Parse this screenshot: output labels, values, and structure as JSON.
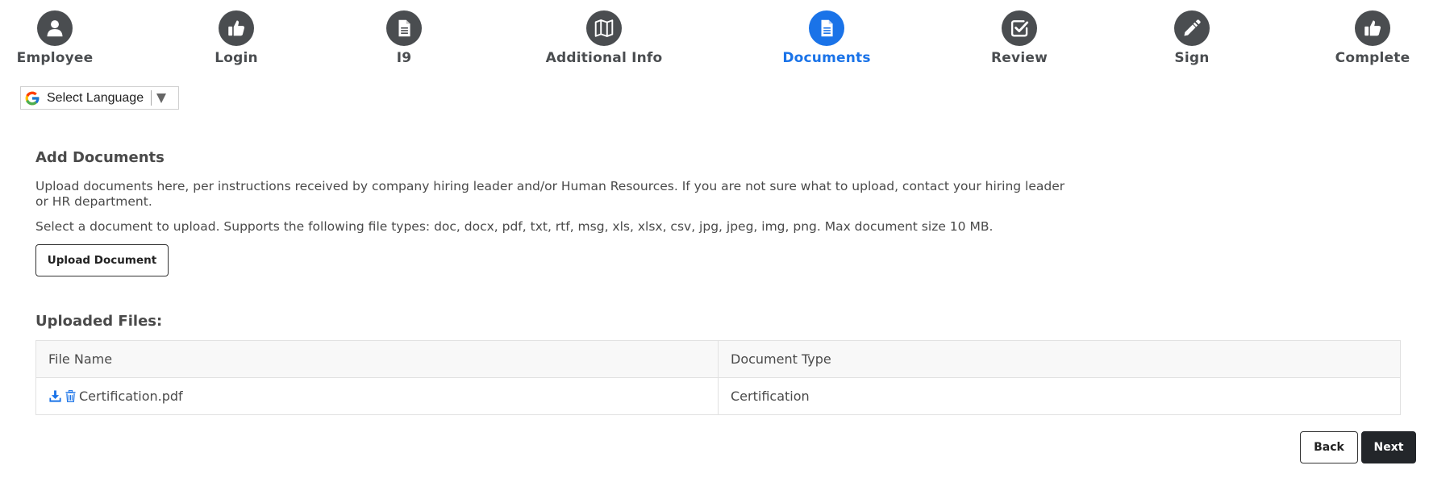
{
  "stepper": {
    "steps": [
      {
        "label": "Employee",
        "icon": "user-icon",
        "state": "default"
      },
      {
        "label": "Login",
        "icon": "thumbs-up-icon",
        "state": "default"
      },
      {
        "label": "I9",
        "icon": "document-icon",
        "state": "default"
      },
      {
        "label": "Additional Info",
        "icon": "map-icon",
        "state": "default"
      },
      {
        "label": "Documents",
        "icon": "document-icon",
        "state": "active"
      },
      {
        "label": "Review",
        "icon": "check-square-icon",
        "state": "default"
      },
      {
        "label": "Sign",
        "icon": "pencil-icon",
        "state": "default"
      },
      {
        "label": "Complete",
        "icon": "thumbs-up-icon",
        "state": "default"
      }
    ],
    "colors": {
      "default": "#4a4d50",
      "active": "#1a73e8"
    }
  },
  "language": {
    "label": "Select Language",
    "icon": "google-icon"
  },
  "add_documents": {
    "title": "Add Documents",
    "instructions": "Upload documents here, per instructions received by company hiring leader and/or Human Resources. If you are not sure what to upload, contact your hiring leader or HR department.",
    "filetypes": "Select a document to upload. Supports the following file types: doc, docx, pdf, txt, rtf, msg, xls, xlsx, csv, jpg, jpeg, img, png. Max document size 10 MB.",
    "upload_label": "Upload Document"
  },
  "uploaded": {
    "title": "Uploaded Files:",
    "columns": [
      "File Name",
      "Document Type"
    ],
    "rows": [
      {
        "file_name": "Certification.pdf",
        "document_type": "Certification",
        "icons": [
          "download-icon",
          "trash-icon"
        ]
      }
    ],
    "icon_color": "#1a73e8"
  },
  "nav": {
    "back_label": "Back",
    "next_label": "Next"
  }
}
